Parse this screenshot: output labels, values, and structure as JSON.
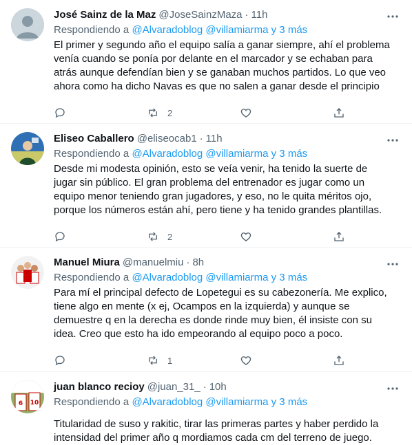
{
  "tweets": [
    {
      "name": "José Sainz de la Maz",
      "handle": "@JoseSainzMaza",
      "time": "11h",
      "replying_prefix": "Respondiendo a",
      "mentions": "@Alvaradoblog @villamiarma",
      "and_more": "y 3 más",
      "text": "El primer y segundo año el equipo salía a ganar siempre, ahí el problema venía cuando se ponía por delante en el marcador y se echaban para atrás aunque defendían bien y se ganaban muchos partidos. Lo que veo ahora como ha dicho Navas es que no salen a ganar desde el principio",
      "reply_count": "",
      "retweet_count": "2",
      "like_count": "",
      "avatar": "default-avatar-icon"
    },
    {
      "name": "Eliseo Caballero",
      "handle": "@eliseocab1",
      "time": "11h",
      "replying_prefix": "Respondiendo a",
      "mentions": "@Alvaradoblog @villamiarma",
      "and_more": "y 3 más",
      "text": "Desde mi modesta opinión, esto se veía venir, ha tenido la suerte de jugar sin público. El gran problema del entrenador es jugar como un equipo menor teniendo gran jugadores, y eso, no le quita méritos ojo, porque los números están ahí, pero tiene y ha tenido grandes plantillas.",
      "reply_count": "",
      "retweet_count": "2",
      "like_count": "",
      "avatar": "photo-avatar-icon"
    },
    {
      "name": "Manuel Miura",
      "handle": "@manuelmiu",
      "time": "8h",
      "replying_prefix": "Respondiendo a",
      "mentions": "@Alvaradoblog @villamiarma",
      "and_more": "y 3 más",
      "text": "Para mí el principal defecto de Lopetegui es su cabezonería. Me explico, tiene algo en mente (x ej, Ocampos en la izquierda) y aunque se demuestre q en la derecha es donde rinde muy bien, él insiste con su idea. Creo que esto ha ido empeorando al equipo poco a poco.",
      "reply_count": "",
      "retweet_count": "1",
      "like_count": "",
      "avatar": "team-avatar-icon"
    },
    {
      "name": "juan blanco recioy",
      "handle": "@juan_31_",
      "time": "10h",
      "replying_prefix": "Respondiendo a",
      "mentions": "@Alvaradoblog @villamiarma",
      "and_more": "y 3 más",
      "text": "Titularidad de suso y rakitic, tirar las primeras partes y haber perdido la intensidad del primer año q mordiamos cada cm del terreno de juego.",
      "reply_count": "",
      "retweet_count": "",
      "like_count": "",
      "avatar": "player-avatar-icon"
    }
  ]
}
